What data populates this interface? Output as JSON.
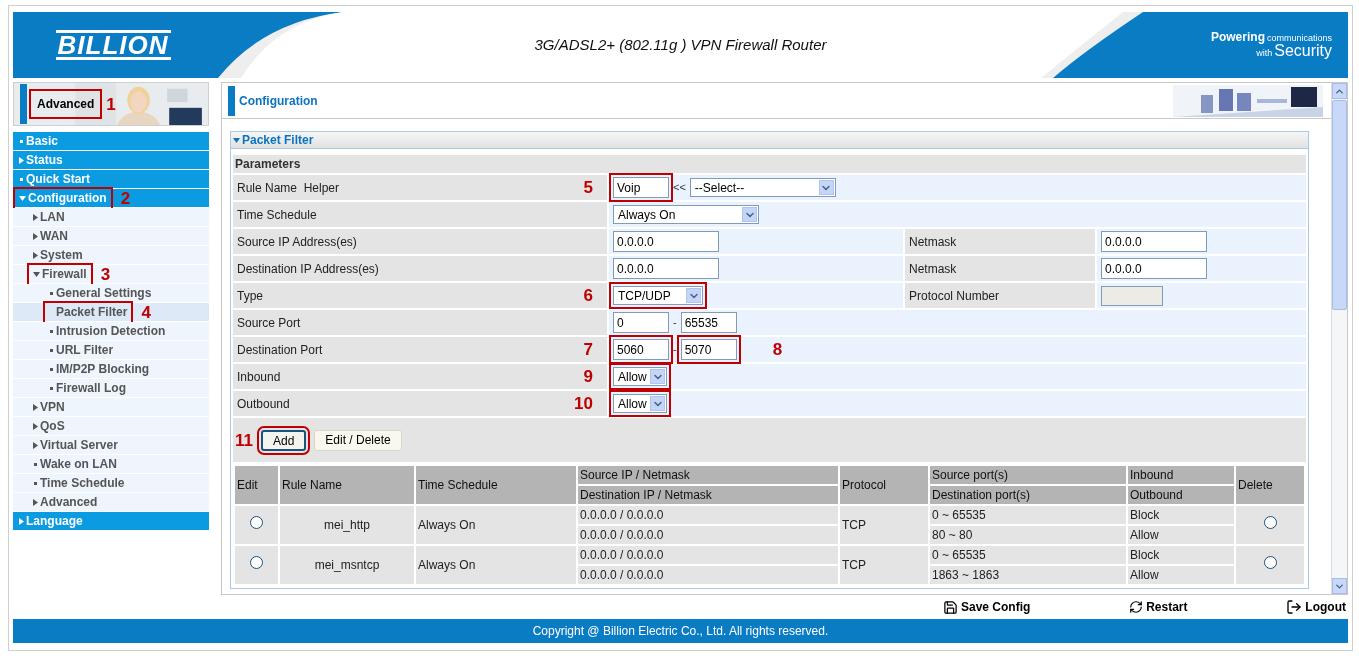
{
  "header": {
    "logo": "BILLION",
    "title": "3G/ADSL2+ (802.11g ) VPN Firewall Router",
    "tagline_lead": "Powering",
    "tagline_small": "communications",
    "tagline_with": "with",
    "tagline_big": "Security"
  },
  "sidebar": {
    "banner": {
      "label": "Advanced",
      "callout": "1"
    },
    "items": [
      {
        "label": "Basic"
      },
      {
        "label": "Status",
        "expanded": false
      },
      {
        "label": "Quick Start"
      },
      {
        "label": "Configuration",
        "expanded": true,
        "callout": "2",
        "children": [
          {
            "label": "LAN",
            "expanded": false
          },
          {
            "label": "WAN",
            "expanded": false
          },
          {
            "label": "System",
            "expanded": false
          },
          {
            "label": "Firewall",
            "expanded": true,
            "callout": "3",
            "children": [
              {
                "label": "General Settings",
                "selected": false
              },
              {
                "label": "Packet Filter",
                "selected": true,
                "callout": "4"
              },
              {
                "label": "Intrusion Detection",
                "selected": false
              },
              {
                "label": "URL Filter",
                "selected": false
              },
              {
                "label": "IM/P2P Blocking",
                "selected": false
              },
              {
                "label": "Firewall Log",
                "selected": false
              }
            ]
          },
          {
            "label": "VPN",
            "expanded": false
          },
          {
            "label": "QoS",
            "expanded": false
          },
          {
            "label": "Virtual Server",
            "expanded": false
          },
          {
            "label": "Wake on LAN"
          },
          {
            "label": "Time Schedule"
          },
          {
            "label": "Advanced",
            "expanded": false
          }
        ]
      },
      {
        "label": "Language",
        "expanded": false
      }
    ]
  },
  "main": {
    "page_title": "Configuration",
    "section": {
      "title": "Packet Filter",
      "expanded": true
    },
    "parameters_title": "Parameters",
    "rows": [
      {
        "label": "Rule Name  Helper",
        "callout": "5",
        "fields": [
          {
            "kind": "input",
            "value": "Voip",
            "highlighted": true
          },
          {
            "kind": "text",
            "value": "<<"
          },
          {
            "kind": "select",
            "value": "--Select--",
            "highlighted": false
          }
        ]
      },
      {
        "label": "Time Schedule",
        "fields": [
          {
            "kind": "select",
            "value": "Always On",
            "highlighted": false
          }
        ]
      },
      {
        "label": "Source IP Address(es)",
        "fields": [
          {
            "kind": "input",
            "value": "0.0.0.0",
            "highlighted": false
          }
        ],
        "side": {
          "label": "Netmask",
          "field": {
            "kind": "input",
            "value": "0.0.0.0"
          }
        }
      },
      {
        "label": "Destination IP Address(es)",
        "fields": [
          {
            "kind": "input",
            "value": "0.0.0.0",
            "highlighted": false
          }
        ],
        "side": {
          "label": "Netmask",
          "field": {
            "kind": "input",
            "value": "0.0.0.0"
          }
        }
      },
      {
        "label": "Type",
        "callout": "6",
        "fields": [
          {
            "kind": "select",
            "value": "TCP/UDP",
            "highlighted": true
          }
        ],
        "side": {
          "label": "Protocol Number",
          "field": {
            "kind": "input",
            "disabled": true
          }
        }
      },
      {
        "label": "Source Port",
        "fields": [
          {
            "kind": "input",
            "value": "0",
            "highlighted": false
          },
          {
            "kind": "text",
            "value": "-"
          },
          {
            "kind": "input",
            "value": "65535",
            "highlighted": false
          }
        ]
      },
      {
        "label": "Destination Port",
        "callout": "7",
        "fields": [
          {
            "kind": "input",
            "value": "5060",
            "highlighted": true
          },
          {
            "kind": "text",
            "value": "-"
          },
          {
            "kind": "input",
            "value": "5070",
            "highlighted": true
          }
        ],
        "after_callout": "8"
      },
      {
        "label": "Inbound",
        "callout": "9",
        "fields": [
          {
            "kind": "select",
            "value": "Allow",
            "highlighted": true
          }
        ]
      },
      {
        "label": "Outbound",
        "callout": "10",
        "fields": [
          {
            "kind": "select",
            "value": "Allow",
            "highlighted": true
          }
        ]
      }
    ],
    "buttons_callout": "11",
    "buttons": [
      {
        "label": "Add",
        "highlighted": true
      },
      {
        "label": "Edit / Delete",
        "highlighted": false
      }
    ],
    "table": {
      "columns": {
        "edit": "Edit",
        "rule_name": "Rule Name",
        "time_schedule": "Time Schedule",
        "source_ip": "Source IP / Netmask",
        "destination_ip": "Destination IP / Netmask",
        "protocol": "Protocol",
        "source_ports": "Source port(s)",
        "destination_ports": "Destination port(s)",
        "inbound": "Inbound",
        "outbound": "Outbound",
        "delete": "Delete"
      },
      "rows": [
        {
          "edit_selected": false,
          "rule_name": "mei_http",
          "time_schedule": "Always On",
          "source_ip": "0.0.0.0 / 0.0.0.0",
          "destination_ip": "0.0.0.0 / 0.0.0.0",
          "protocol": "TCP",
          "source_ports": "0 ~ 65535",
          "destination_ports": "80 ~ 80",
          "inbound": "Block",
          "outbound": "Allow",
          "delete_selected": false
        },
        {
          "edit_selected": false,
          "rule_name": "mei_msntcp",
          "time_schedule": "Always On",
          "source_ip": "0.0.0.0 / 0.0.0.0",
          "destination_ip": "0.0.0.0 / 0.0.0.0",
          "protocol": "TCP",
          "source_ports": "0 ~ 65535",
          "destination_ports": "1863 ~ 1863",
          "inbound": "Block",
          "outbound": "Allow",
          "delete_selected": false
        }
      ]
    }
  },
  "actions": [
    {
      "kind": "save",
      "label": "Save Config"
    },
    {
      "kind": "restart",
      "label": "Restart"
    },
    {
      "kind": "logout",
      "label": "Logout"
    }
  ],
  "footer": "Copyright @ Billion Electric Co., Ltd. All rights reserved."
}
